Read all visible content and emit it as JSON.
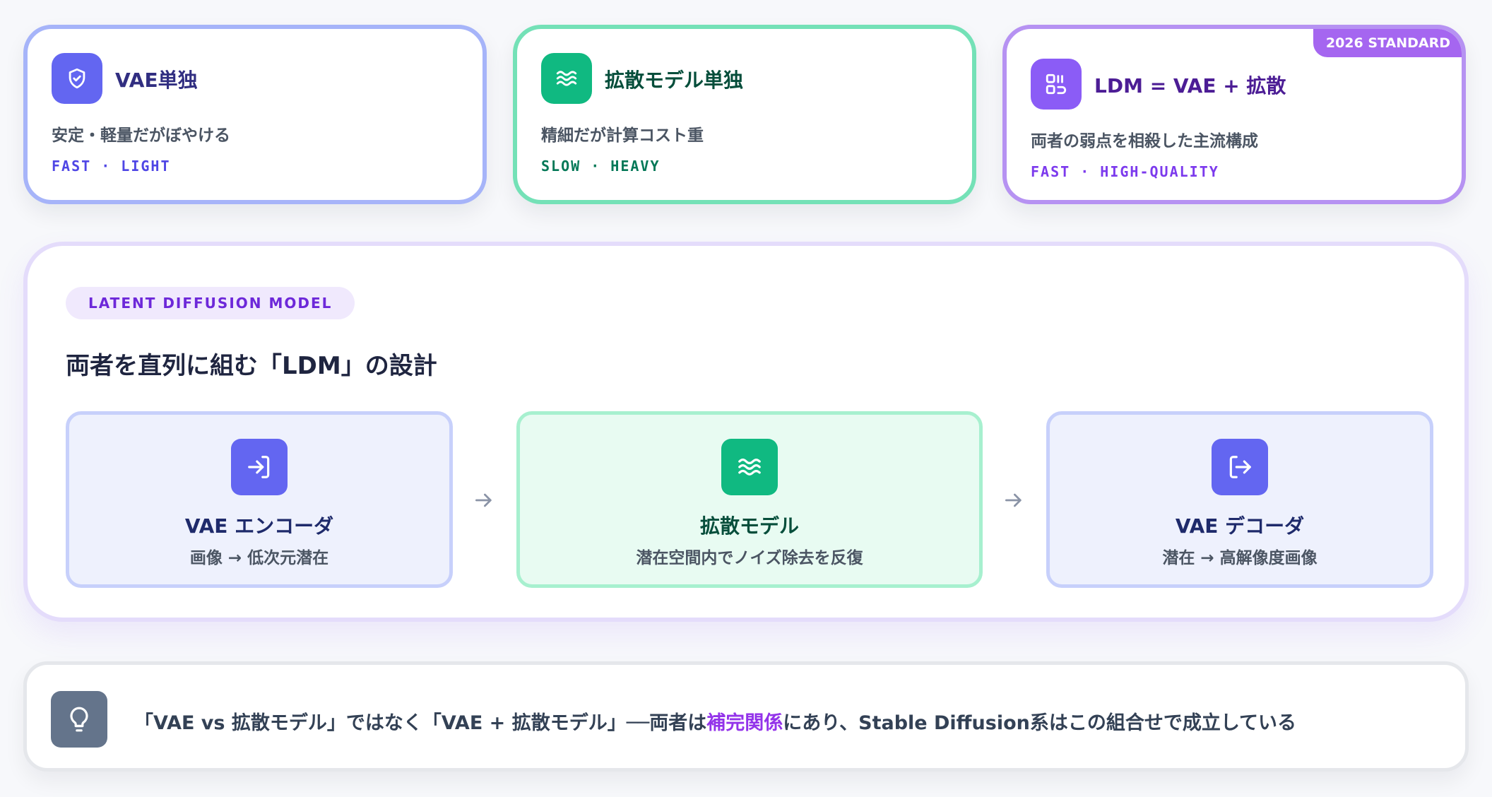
{
  "cards": [
    {
      "icon": "shield-icon",
      "title": "VAE単独",
      "description": "安定・軽量だがぼやける",
      "tags": "FAST · LIGHT"
    },
    {
      "icon": "waves-icon",
      "title": "拡散モデル単独",
      "description": "精細だが計算コスト重",
      "tags": "SLOW · HEAVY"
    },
    {
      "icon": "combine-icon",
      "title": "LDM = VAE + 拡散",
      "description": "両者の弱点を相殺した主流構成",
      "tags": "FAST · HIGH-QUALITY",
      "badge": "2026 STANDARD"
    }
  ],
  "main": {
    "pill": "LATENT DIFFUSION MODEL",
    "title": "両者を直列に組む「LDM」の設計",
    "steps": [
      {
        "icon": "login-icon",
        "title": "VAE エンコーダ",
        "description": "画像 → 低次元潜在"
      },
      {
        "icon": "waves-icon",
        "title": "拡散モデル",
        "description": "潜在空間内でノイズ除去を反復"
      },
      {
        "icon": "logout-icon",
        "title": "VAE デコーダ",
        "description": "潜在 → 高解像度画像"
      }
    ]
  },
  "note": {
    "icon": "lightbulb-icon",
    "before": "「VAE vs 拡散モデル」ではなく「VAE + 拡散モデル」──両者は",
    "highlight": "補完関係",
    "after": "にあり、Stable Diffusion系はこの組合せで成立している"
  },
  "colors": {
    "indigo": "#6366f1",
    "emerald": "#10b981",
    "violet": "#8b5cf6",
    "slate": "#64748b",
    "highlight": "#9333ea"
  }
}
